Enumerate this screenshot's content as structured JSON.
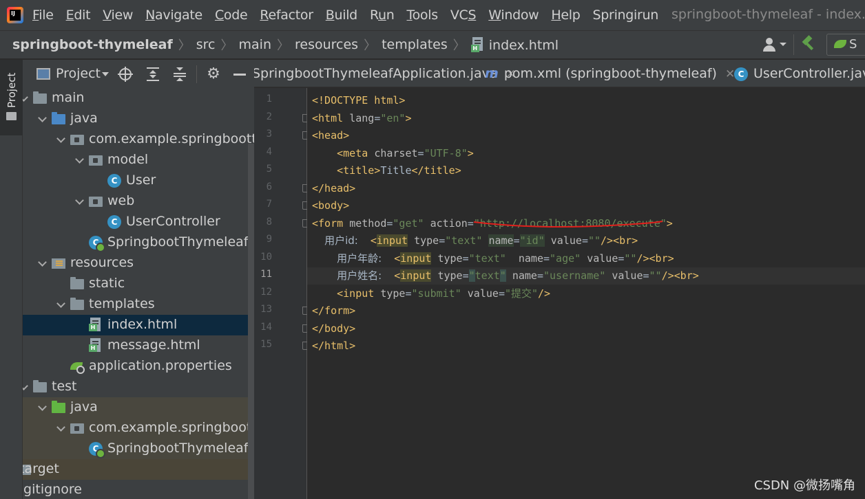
{
  "menubar": {
    "logo": "IJ",
    "items": [
      {
        "label": "File",
        "mnemonic": "F",
        "rest": "ile"
      },
      {
        "label": "Edit",
        "mnemonic": "E",
        "rest": "dit"
      },
      {
        "label": "View",
        "mnemonic": "V",
        "rest": "iew"
      },
      {
        "label": "Navigate",
        "mnemonic": "N",
        "rest": "avigate"
      },
      {
        "label": "Code",
        "mnemonic": "C",
        "rest": "ode"
      },
      {
        "label": "Refactor",
        "mnemonic": "R",
        "rest": "efactor"
      },
      {
        "label": "Build",
        "mnemonic": "B",
        "rest": "uild"
      },
      {
        "label": "Run",
        "pre": "R",
        "mnemonic": "u",
        "rest": "n"
      },
      {
        "label": "Tools",
        "mnemonic": "T",
        "rest": "ools"
      },
      {
        "label": "VCS",
        "pre": "VC",
        "mnemonic": "S",
        "rest": ""
      },
      {
        "label": "Window",
        "mnemonic": "W",
        "rest": "indow"
      },
      {
        "label": "Help",
        "mnemonic": "H",
        "rest": "elp"
      },
      {
        "label": "Springirun",
        "mnemonic": "",
        "rest": "Springirun"
      }
    ],
    "window_title": "springboot-thymeleaf - index.html"
  },
  "breadcrumb": {
    "project": "springboot-thymeleaf",
    "parts": [
      "src",
      "main",
      "resources",
      "templates"
    ],
    "file": "index.html",
    "run_config_label": "S"
  },
  "toolstrip": {
    "project_tab": "Project"
  },
  "project_panel": {
    "title": "Project",
    "tree": [
      {
        "label": "main",
        "icon": "folder",
        "arrow": true,
        "indent": 0
      },
      {
        "label": "java",
        "icon": "folder-blue",
        "arrow": true,
        "indent": 1
      },
      {
        "label": "com.example.springbootthymeleaf",
        "icon": "package",
        "arrow": true,
        "indent": 2
      },
      {
        "label": "model",
        "icon": "package",
        "arrow": true,
        "indent": 3
      },
      {
        "label": "User",
        "icon": "class",
        "arrow": false,
        "indent": 4
      },
      {
        "label": "web",
        "icon": "package",
        "arrow": true,
        "indent": 3
      },
      {
        "label": "UserController",
        "icon": "class",
        "arrow": false,
        "indent": 4
      },
      {
        "label": "SpringbootThymeleafApplication",
        "icon": "spring",
        "arrow": false,
        "indent": 3
      },
      {
        "label": "resources",
        "icon": "resources",
        "arrow": true,
        "indent": 1
      },
      {
        "label": "static",
        "icon": "folder",
        "arrow": false,
        "indent": 2
      },
      {
        "label": "templates",
        "icon": "folder",
        "arrow": true,
        "indent": 2
      },
      {
        "label": "index.html",
        "icon": "html",
        "arrow": false,
        "indent": 3,
        "selected": true
      },
      {
        "label": "message.html",
        "icon": "html",
        "arrow": false,
        "indent": 3
      },
      {
        "label": "application.properties",
        "icon": "props",
        "arrow": false,
        "indent": 2
      },
      {
        "label": "test",
        "icon": "folder",
        "arrow": true,
        "indent": 0
      },
      {
        "label": "java",
        "icon": "folder-green",
        "arrow": true,
        "indent": 1,
        "tint": "test"
      },
      {
        "label": "com.example.springbootthymeleaf",
        "icon": "package",
        "arrow": true,
        "indent": 2,
        "tint": "test"
      },
      {
        "label": "SpringbootThymeleafApplicationTests",
        "icon": "spring",
        "arrow": false,
        "indent": 3,
        "tint": "test"
      },
      {
        "label": "target",
        "icon": "folder",
        "arrow": true,
        "indent": -1,
        "tint": "target"
      },
      {
        "label": ".gitignore",
        "icon": "none",
        "arrow": false,
        "indent": -1
      }
    ]
  },
  "editor": {
    "tabs": [
      {
        "label": "SpringbootThymeleafApplication.java",
        "icon": "none",
        "closable": true
      },
      {
        "label": "pom.xml (springboot-thymeleaf)",
        "icon": "m",
        "closable": true
      },
      {
        "label": "UserController.java",
        "icon": "c",
        "closable": false
      }
    ],
    "current_line": 11,
    "lines": [
      [
        {
          "t": "<!DOCTYPE html>",
          "c": "doc"
        }
      ],
      [
        {
          "t": "<html ",
          "c": "tag"
        },
        {
          "t": "lang",
          "c": "attr"
        },
        {
          "t": "=",
          "c": "text"
        },
        {
          "t": "\"en\"",
          "c": "str"
        },
        {
          "t": ">",
          "c": "tag"
        }
      ],
      [
        {
          "t": "<head>",
          "c": "tag"
        }
      ],
      [
        {
          "t": "    ",
          "c": "text"
        },
        {
          "t": "<meta ",
          "c": "tag"
        },
        {
          "t": "charset",
          "c": "attr"
        },
        {
          "t": "=",
          "c": "text"
        },
        {
          "t": "\"UTF-8\"",
          "c": "str"
        },
        {
          "t": ">",
          "c": "tag"
        }
      ],
      [
        {
          "t": "    ",
          "c": "text"
        },
        {
          "t": "<title>",
          "c": "tag"
        },
        {
          "t": "Title",
          "c": "text"
        },
        {
          "t": "</title>",
          "c": "tag"
        }
      ],
      [
        {
          "t": "</head>",
          "c": "tag"
        }
      ],
      [
        {
          "t": "<body>",
          "c": "tag"
        }
      ],
      [
        {
          "t": "<form ",
          "c": "tag"
        },
        {
          "t": "method",
          "c": "attr"
        },
        {
          "t": "=",
          "c": "text"
        },
        {
          "t": "\"get\"",
          "c": "str"
        },
        {
          "t": " action",
          "c": "attr"
        },
        {
          "t": "=",
          "c": "text"
        },
        {
          "t": "\"http://localhost:8080/execute\"",
          "c": "str"
        },
        {
          "t": ">",
          "c": "tag"
        }
      ],
      [
        {
          "t": "  ",
          "c": "text"
        },
        {
          "t": "用户id:",
          "c": "cn"
        },
        {
          "t": "  <",
          "c": "tag"
        },
        {
          "t": "input",
          "c": "tag",
          "hl": "input"
        },
        {
          "t": " type",
          "c": "attr"
        },
        {
          "t": "=",
          "c": "text"
        },
        {
          "t": "\"text\"",
          "c": "str"
        },
        {
          "t": " ",
          "c": "text"
        },
        {
          "t": "name",
          "c": "attr",
          "hl": "name"
        },
        {
          "t": "=",
          "c": "text"
        },
        {
          "t": "\"id\"",
          "c": "str",
          "hl": "name"
        },
        {
          "t": " value",
          "c": "attr"
        },
        {
          "t": "=",
          "c": "text"
        },
        {
          "t": "\"\"",
          "c": "str"
        },
        {
          "t": "/><br>",
          "c": "tag"
        }
      ],
      [
        {
          "t": "    ",
          "c": "text"
        },
        {
          "t": "用户年龄:",
          "c": "cn"
        },
        {
          "t": "  <",
          "c": "tag"
        },
        {
          "t": "input",
          "c": "tag",
          "hl": "input"
        },
        {
          "t": " type",
          "c": "attr"
        },
        {
          "t": "=",
          "c": "text"
        },
        {
          "t": "\"text\"",
          "c": "str"
        },
        {
          "t": "  name",
          "c": "attr"
        },
        {
          "t": "=",
          "c": "text"
        },
        {
          "t": "\"age\"",
          "c": "str"
        },
        {
          "t": " value",
          "c": "attr"
        },
        {
          "t": "=",
          "c": "text"
        },
        {
          "t": "\"\"",
          "c": "str"
        },
        {
          "t": "/><br>",
          "c": "tag"
        }
      ],
      [
        {
          "t": "    ",
          "c": "text"
        },
        {
          "t": "用户姓名:",
          "c": "cn"
        },
        {
          "t": "  <",
          "c": "tag"
        },
        {
          "t": "input",
          "c": "tag",
          "hl": "input"
        },
        {
          "t": " type",
          "c": "attr"
        },
        {
          "t": "=",
          "c": "text"
        },
        {
          "t": "\"",
          "c": "str",
          "hl": "q"
        },
        {
          "t": "text",
          "c": "str"
        },
        {
          "t": "\"",
          "c": "str",
          "hl": "q"
        },
        {
          "t": " name",
          "c": "attr"
        },
        {
          "t": "=",
          "c": "text"
        },
        {
          "t": "\"username\"",
          "c": "str"
        },
        {
          "t": " value",
          "c": "attr"
        },
        {
          "t": "=",
          "c": "text"
        },
        {
          "t": "\"\"",
          "c": "str"
        },
        {
          "t": "/><br>",
          "c": "tag"
        }
      ],
      [
        {
          "t": "    ",
          "c": "text"
        },
        {
          "t": "<input ",
          "c": "tag"
        },
        {
          "t": "type",
          "c": "attr"
        },
        {
          "t": "=",
          "c": "text"
        },
        {
          "t": "\"submit\"",
          "c": "str"
        },
        {
          "t": " value",
          "c": "attr"
        },
        {
          "t": "=",
          "c": "text"
        },
        {
          "t": "\"提交\"",
          "c": "str"
        },
        {
          "t": "/>",
          "c": "tag"
        }
      ],
      [
        {
          "t": "</form>",
          "c": "tag"
        }
      ],
      [
        {
          "t": "</body>",
          "c": "tag"
        }
      ],
      [
        {
          "t": "</html>",
          "c": "tag"
        }
      ]
    ],
    "fold_lines": [
      2,
      3,
      6,
      7,
      8,
      13,
      14,
      15
    ]
  },
  "watermark": "CSDN @微扬嘴角",
  "colors": {
    "tag": "#e8bf6a",
    "attr": "#bababa",
    "string": "#6a8759",
    "text": "#a9b7c6",
    "selection": "#0d293e",
    "annotation_underline": "#e0201c"
  }
}
